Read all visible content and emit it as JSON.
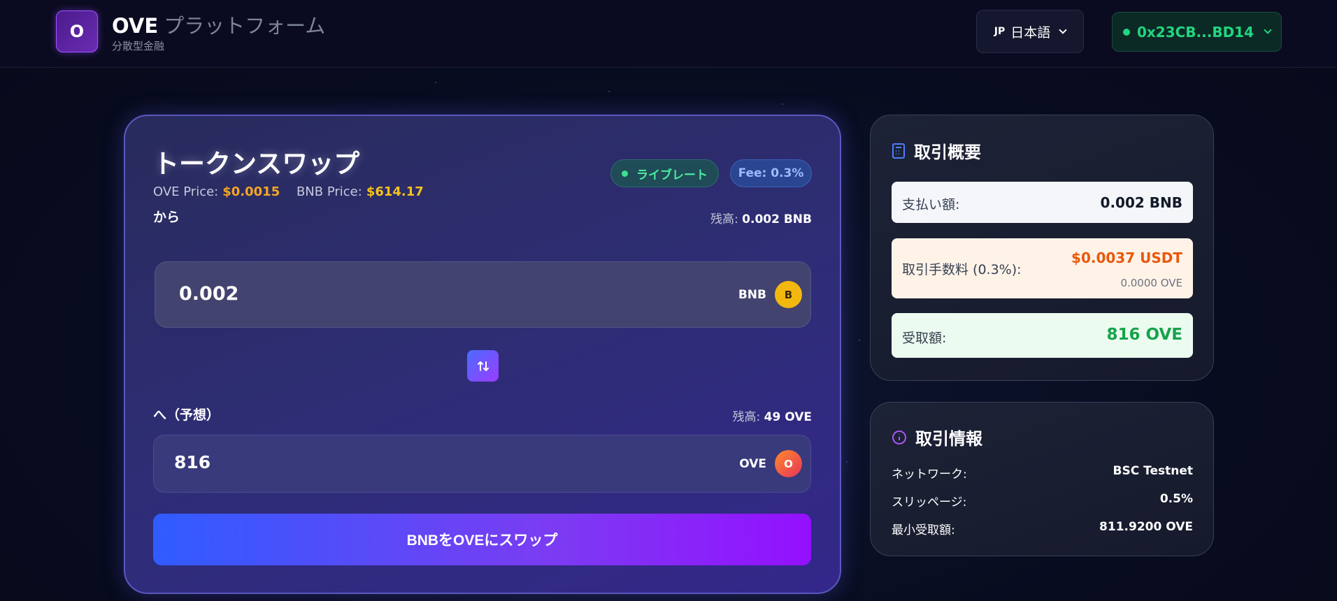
{
  "header": {
    "logo_letter": "O",
    "brand_name": "OVE",
    "brand_suffix": "プラットフォーム",
    "brand_sub": "分散型金融",
    "language": {
      "flag": "JP",
      "label": "日本語"
    },
    "wallet": {
      "address": "0x23CB...BD14"
    }
  },
  "swap": {
    "title": "トークンスワップ",
    "ove_price_label": "OVE Price:",
    "ove_price": "$0.0015",
    "bnb_price_label": "BNB Price:",
    "bnb_price": "$614.17",
    "live_badge": "ライブレート",
    "fee_badge": "Fee: 0.3%",
    "from": {
      "label": "から",
      "balance_label": "残高:",
      "balance_value": "0.002 BNB",
      "amount": "0.002",
      "token": "BNB",
      "token_icon": "B"
    },
    "to": {
      "label": "へ（予想）",
      "balance_label": "残高:",
      "balance_value": "49 OVE",
      "amount": "816",
      "token": "OVE",
      "token_icon": "O"
    },
    "swap_button": "BNBをOVEにスワップ"
  },
  "summary": {
    "title": "取引概要",
    "pay_label": "支払い額:",
    "pay_value": "0.002 BNB",
    "fee_label": "取引手数料 (0.3%):",
    "fee_value": "$0.0037 USDT",
    "fee_sub": "0.0000 OVE",
    "receive_label": "受取額:",
    "receive_value": "816 OVE"
  },
  "info": {
    "title": "取引情報",
    "rows": [
      {
        "label": "ネットワーク:",
        "value": "BSC Testnet"
      },
      {
        "label": "スリッページ:",
        "value": "0.5%"
      },
      {
        "label": "最小受取額:",
        "value": "811.9200 OVE"
      }
    ]
  },
  "colors": {
    "accent_purple": "#9510ff",
    "accent_blue": "#2f5cff",
    "wallet_green": "#22d67f",
    "ove_price_orange": "#f5a623",
    "bnb_yellow": "#f3b80f",
    "fee_orange": "#ea580c",
    "receive_green": "#16a34a"
  },
  "icons": {
    "swap_direction": "swap-arrows-icon",
    "summary": "calculator-icon",
    "info": "info-circle-icon"
  }
}
